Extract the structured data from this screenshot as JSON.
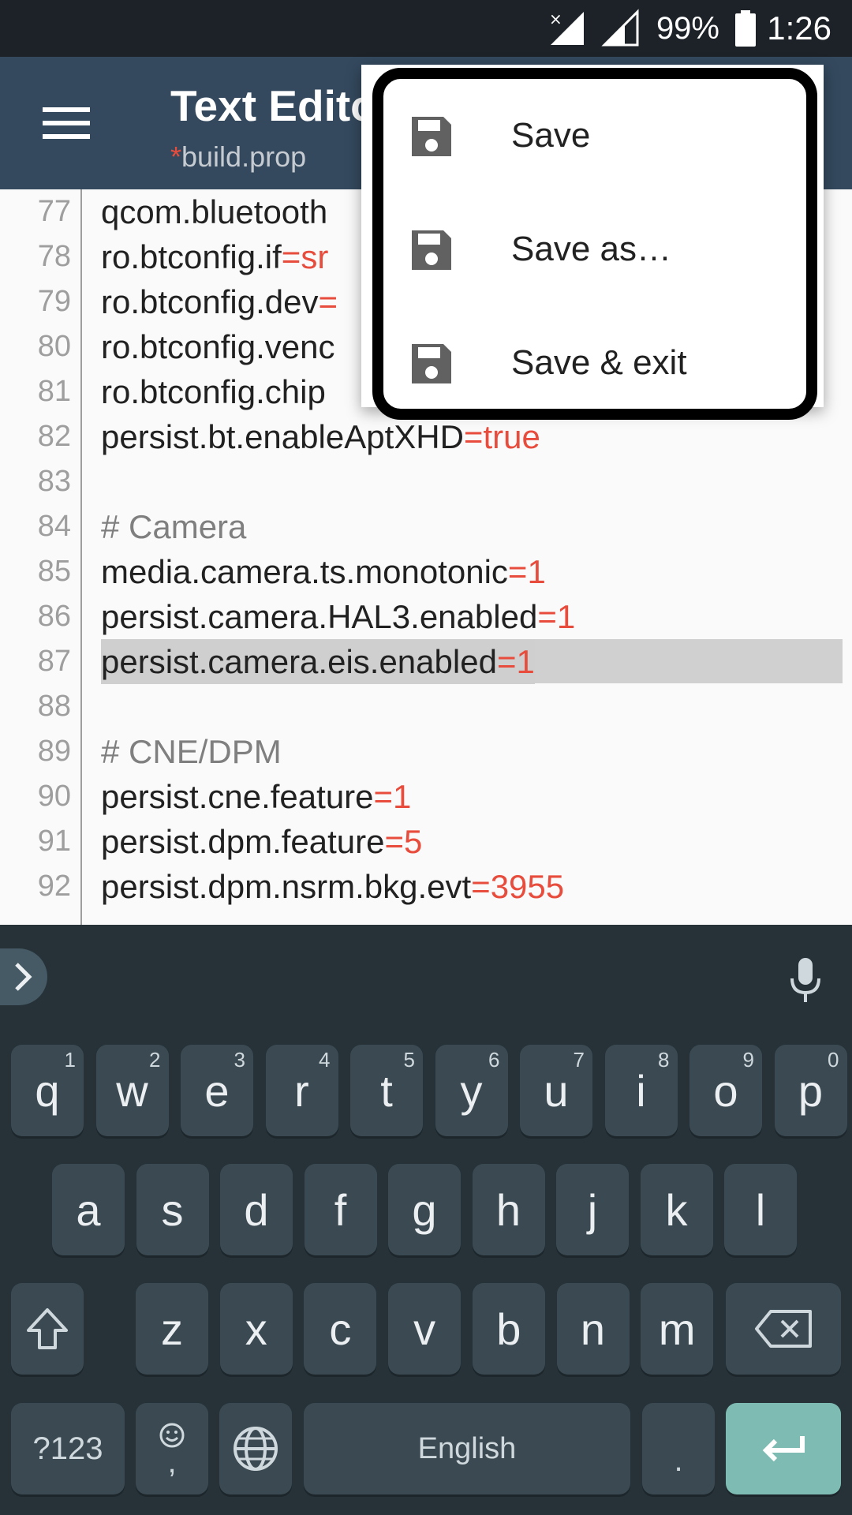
{
  "status_bar": {
    "battery_percent": "99%",
    "time": "1:26"
  },
  "app_bar": {
    "title": "Text Editor",
    "modified_marker": "*",
    "file_name": "build.prop"
  },
  "editor": {
    "lines": [
      {
        "n": "77",
        "key": "qcom.bluetooth",
        "sep": "",
        "val": "",
        "type": "kv"
      },
      {
        "n": "78",
        "key": "ro.btconfig.if",
        "sep": "=",
        "val": "sr",
        "type": "kv"
      },
      {
        "n": "79",
        "key": "ro.btconfig.dev",
        "sep": "=",
        "val": "",
        "type": "kv"
      },
      {
        "n": "80",
        "key": "ro.btconfig.venc",
        "sep": "",
        "val": "",
        "type": "kv"
      },
      {
        "n": "81",
        "key": "ro.btconfig.chip",
        "sep": "",
        "val": "",
        "type": "kv"
      },
      {
        "n": "82",
        "key": "persist.bt.enableAptXHD",
        "sep": "=",
        "val": "true",
        "type": "kv"
      },
      {
        "n": "83",
        "key": "",
        "sep": "",
        "val": "",
        "type": "kv"
      },
      {
        "n": "84",
        "key": "# Camera",
        "sep": "",
        "val": "",
        "type": "comment"
      },
      {
        "n": "85",
        "key": "media.camera.ts.monotonic",
        "sep": "=",
        "val": "1",
        "type": "kv"
      },
      {
        "n": "86",
        "key": "persist.camera.HAL3.enabled",
        "sep": "=",
        "val": "1",
        "type": "kv"
      },
      {
        "n": "87",
        "key": "persist.camera.eis.enabled",
        "sep": "=",
        "val": "1",
        "type": "kv",
        "current": true
      },
      {
        "n": "88",
        "key": "",
        "sep": "",
        "val": "",
        "type": "kv"
      },
      {
        "n": "89",
        "key": "# CNE/DPM",
        "sep": "",
        "val": "",
        "type": "comment"
      },
      {
        "n": "90",
        "key": "persist.cne.feature",
        "sep": "=",
        "val": "1",
        "type": "kv"
      },
      {
        "n": "91",
        "key": "persist.dpm.feature",
        "sep": "=",
        "val": "5",
        "type": "kv"
      },
      {
        "n": "92",
        "key": "persist.dpm.nsrm.bkg.evt",
        "sep": "=",
        "val": "3955",
        "type": "kv"
      }
    ]
  },
  "popup_menu": {
    "items": [
      {
        "label": "Save",
        "icon": "save-icon"
      },
      {
        "label": "Save as…",
        "icon": "save-as-icon"
      },
      {
        "label": "Save & exit",
        "icon": "save-exit-icon"
      }
    ]
  },
  "keyboard": {
    "row1": [
      [
        "q",
        "1"
      ],
      [
        "w",
        "2"
      ],
      [
        "e",
        "3"
      ],
      [
        "r",
        "4"
      ],
      [
        "t",
        "5"
      ],
      [
        "y",
        "6"
      ],
      [
        "u",
        "7"
      ],
      [
        "i",
        "8"
      ],
      [
        "o",
        "9"
      ],
      [
        "p",
        "0"
      ]
    ],
    "row2": [
      "a",
      "s",
      "d",
      "f",
      "g",
      "h",
      "j",
      "k",
      "l"
    ],
    "row3": [
      "z",
      "x",
      "c",
      "v",
      "b",
      "n",
      "m"
    ],
    "symbols_label": "?123",
    "comma_label": ",",
    "space_label": "English",
    "period_label": ".",
    "colors": {
      "enter_key": "#7ebcb3",
      "key_bg": "#3b4a52",
      "keyboard_bg": "#263238"
    }
  }
}
